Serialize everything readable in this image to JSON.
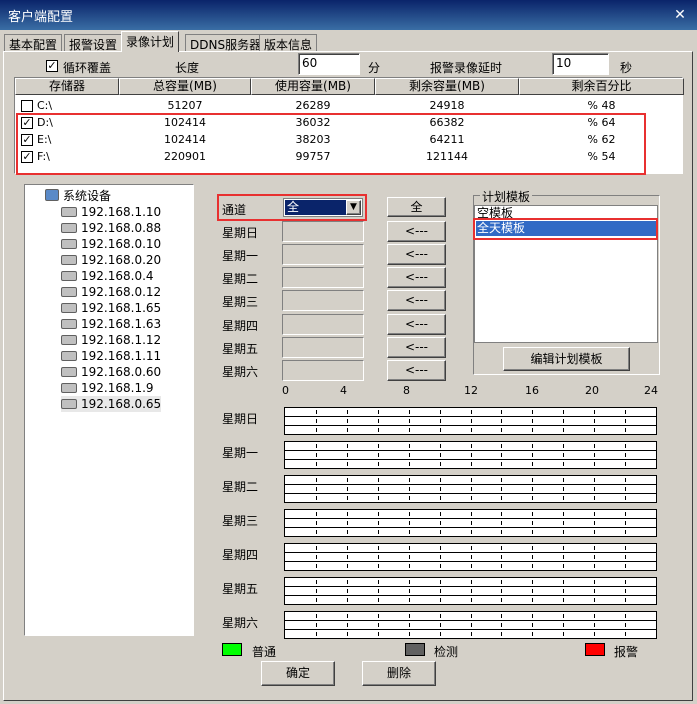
{
  "window": {
    "title": "客户端配置",
    "close": "✕"
  },
  "tabs": [
    "基本配置",
    "报警设置",
    "录像计划",
    "DDNS服务器",
    "版本信息"
  ],
  "options": {
    "loop_label": "循环覆盖",
    "loop_checked": true,
    "length_label": "长度",
    "length_value": "60",
    "length_unit": "分",
    "delay_label": "报警录像延时",
    "delay_value": "10",
    "delay_unit": "秒"
  },
  "storage": {
    "headers": [
      "存储器",
      "总容量(MB)",
      "使用容量(MB)",
      "剩余容量(MB)",
      "剩余百分比"
    ],
    "rows": [
      {
        "drive": "C:\\",
        "checked": false,
        "total": "51207",
        "used": "26289",
        "free": "24918",
        "pct": "% 48"
      },
      {
        "drive": "D:\\",
        "checked": true,
        "total": "102414",
        "used": "36032",
        "free": "66382",
        "pct": "% 64"
      },
      {
        "drive": "E:\\",
        "checked": true,
        "total": "102414",
        "used": "38203",
        "free": "64211",
        "pct": "% 62"
      },
      {
        "drive": "F:\\",
        "checked": true,
        "total": "220901",
        "used": "99757",
        "free": "121144",
        "pct": "% 54"
      }
    ]
  },
  "tree": {
    "root": "系统设备",
    "devices": [
      "192.168.1.10",
      "192.168.0.88",
      "192.168.0.10",
      "192.168.0.20",
      "192.168.0.4",
      "192.168.0.12",
      "192.168.1.65",
      "192.168.1.63",
      "192.168.1.12",
      "192.168.1.11",
      "192.168.0.60",
      "192.168.1.9",
      "192.168.0.65"
    ],
    "selected": "192.168.0.65"
  },
  "channel": {
    "label": "通道",
    "value": "全",
    "all_button": "全"
  },
  "days": [
    "星期日",
    "星期一",
    "星期二",
    "星期三",
    "星期四",
    "星期五",
    "星期六"
  ],
  "apply_button": "<---",
  "templates": {
    "group_label": "计划模板",
    "items": [
      "空模板",
      "全天模板"
    ],
    "selected": "全天模板",
    "edit_button": "编辑计划模板"
  },
  "timeline": {
    "hours": [
      "0",
      "4",
      "8",
      "12",
      "16",
      "20",
      "24"
    ]
  },
  "legend": [
    {
      "label": "普通",
      "color": "#00ff00"
    },
    {
      "label": "检测",
      "color": "#606060"
    },
    {
      "label": "报警",
      "color": "#ff0000"
    }
  ],
  "footer": {
    "ok": "确定",
    "delete": "删除"
  }
}
